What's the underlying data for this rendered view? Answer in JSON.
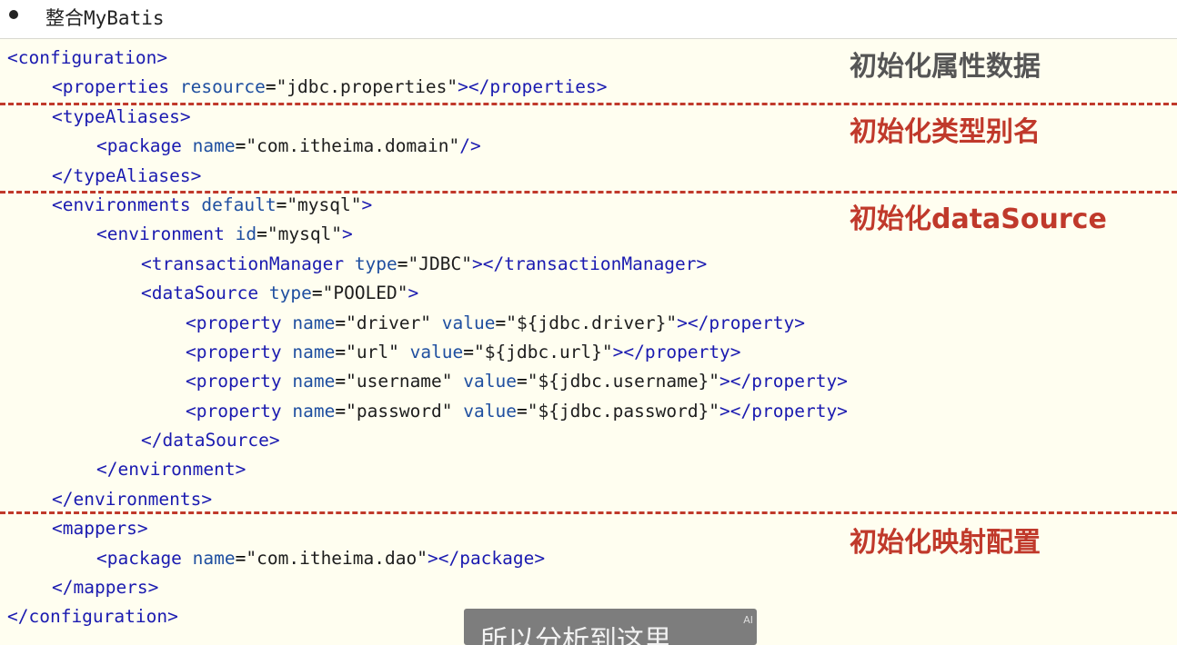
{
  "header": {
    "title": "整合MyBatis"
  },
  "code_lines": [
    {
      "indent": 0,
      "parts": [
        [
          "tag",
          "<configuration>"
        ]
      ]
    },
    {
      "indent": 1,
      "parts": [
        [
          "tag",
          "<properties "
        ],
        [
          "attr",
          "resource"
        ],
        [
          "punct",
          "="
        ],
        [
          "val",
          "\"jdbc.properties\""
        ],
        [
          "tag",
          "></properties>"
        ]
      ]
    },
    {
      "indent": 1,
      "parts": [
        [
          "tag",
          "<typeAliases>"
        ]
      ]
    },
    {
      "indent": 2,
      "parts": [
        [
          "tag",
          "<package "
        ],
        [
          "attr",
          "name"
        ],
        [
          "punct",
          "="
        ],
        [
          "val",
          "\"com.itheima.domain\""
        ],
        [
          "tag",
          "/>"
        ]
      ]
    },
    {
      "indent": 1,
      "parts": [
        [
          "tag",
          "</typeAliases>"
        ]
      ]
    },
    {
      "indent": 1,
      "parts": [
        [
          "tag",
          "<environments "
        ],
        [
          "attr",
          "default"
        ],
        [
          "punct",
          "="
        ],
        [
          "val",
          "\"mysql\""
        ],
        [
          "tag",
          ">"
        ]
      ]
    },
    {
      "indent": 2,
      "parts": [
        [
          "tag",
          "<environment "
        ],
        [
          "attr",
          "id"
        ],
        [
          "punct",
          "="
        ],
        [
          "val",
          "\"mysql\""
        ],
        [
          "tag",
          ">"
        ]
      ]
    },
    {
      "indent": 3,
      "parts": [
        [
          "tag",
          "<transactionManager "
        ],
        [
          "attr",
          "type"
        ],
        [
          "punct",
          "="
        ],
        [
          "val",
          "\"JDBC\""
        ],
        [
          "tag",
          "></transactionManager>"
        ]
      ]
    },
    {
      "indent": 3,
      "parts": [
        [
          "tag",
          "<dataSource "
        ],
        [
          "attr",
          "type"
        ],
        [
          "punct",
          "="
        ],
        [
          "val",
          "\"POOLED\""
        ],
        [
          "tag",
          ">"
        ]
      ]
    },
    {
      "indent": 4,
      "parts": [
        [
          "tag",
          "<property "
        ],
        [
          "attr",
          "name"
        ],
        [
          "punct",
          "="
        ],
        [
          "val",
          "\"driver\" "
        ],
        [
          "attr",
          "value"
        ],
        [
          "punct",
          "="
        ],
        [
          "val",
          "\"${jdbc.driver}\""
        ],
        [
          "tag",
          "></property>"
        ]
      ]
    },
    {
      "indent": 4,
      "parts": [
        [
          "tag",
          "<property "
        ],
        [
          "attr",
          "name"
        ],
        [
          "punct",
          "="
        ],
        [
          "val",
          "\"url\" "
        ],
        [
          "attr",
          "value"
        ],
        [
          "punct",
          "="
        ],
        [
          "val",
          "\"${jdbc.url}\""
        ],
        [
          "tag",
          "></property>"
        ]
      ]
    },
    {
      "indent": 4,
      "parts": [
        [
          "tag",
          "<property "
        ],
        [
          "attr",
          "name"
        ],
        [
          "punct",
          "="
        ],
        [
          "val",
          "\"username\" "
        ],
        [
          "attr",
          "value"
        ],
        [
          "punct",
          "="
        ],
        [
          "val",
          "\"${jdbc.username}\""
        ],
        [
          "tag",
          "></property>"
        ]
      ]
    },
    {
      "indent": 4,
      "parts": [
        [
          "tag",
          "<property "
        ],
        [
          "attr",
          "name"
        ],
        [
          "punct",
          "="
        ],
        [
          "val",
          "\"password\" "
        ],
        [
          "attr",
          "value"
        ],
        [
          "punct",
          "="
        ],
        [
          "val",
          "\"${jdbc.password}\""
        ],
        [
          "tag",
          "></property>"
        ]
      ]
    },
    {
      "indent": 3,
      "parts": [
        [
          "tag",
          "</dataSource>"
        ]
      ]
    },
    {
      "indent": 2,
      "parts": [
        [
          "tag",
          "</environment>"
        ]
      ]
    },
    {
      "indent": 1,
      "parts": [
        [
          "tag",
          "</environments>"
        ]
      ]
    },
    {
      "indent": 1,
      "parts": [
        [
          "tag",
          "<mappers>"
        ]
      ]
    },
    {
      "indent": 2,
      "parts": [
        [
          "tag",
          "<package "
        ],
        [
          "attr",
          "name"
        ],
        [
          "punct",
          "="
        ],
        [
          "val",
          "\"com.itheima.dao\""
        ],
        [
          "tag",
          "></package>"
        ]
      ]
    },
    {
      "indent": 1,
      "parts": [
        [
          "tag",
          "</mappers>"
        ]
      ]
    },
    {
      "indent": 0,
      "parts": [
        [
          "tag",
          "</configuration>"
        ]
      ]
    }
  ],
  "sections": [
    {
      "label": "初始化属性数据",
      "color": "#555555"
    },
    {
      "label": "初始化类型别名",
      "color": "#c0392b"
    },
    {
      "label": "初始化dataSource",
      "color": "#c0392b"
    },
    {
      "label": "初始化映射配置",
      "color": "#c0392b"
    }
  ],
  "subtitle": {
    "text": "所以分析到这里",
    "badge": "AI"
  },
  "colors": {
    "separator": "#c0392b",
    "background": "#fffef0"
  }
}
